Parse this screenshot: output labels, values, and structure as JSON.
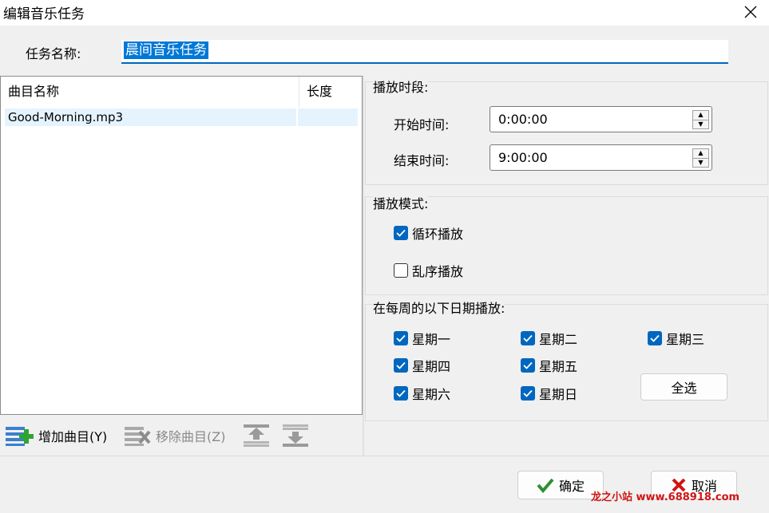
{
  "window": {
    "title": "编辑音乐任务",
    "close_icon": "close-icon"
  },
  "task_name": {
    "label": "任务名称:",
    "value": "晨间音乐任务"
  },
  "song_table": {
    "columns": [
      "曲目名称",
      "长度"
    ],
    "rows": [
      {
        "name": "Good-Morning.mp3",
        "length": ""
      }
    ]
  },
  "toolbar": {
    "add_label": "增加曲目(Y)",
    "remove_label": "移除曲目(Z)",
    "move_up_icon": "move-up-icon",
    "move_down_icon": "move-down-icon"
  },
  "time_period": {
    "title": "播放时段:",
    "start_label": "开始时间:",
    "start_value": "0:00:00",
    "end_label": "结束时间:",
    "end_value": "9:00:00"
  },
  "play_mode": {
    "title": "播放模式:",
    "loop_label": "循环播放",
    "loop_checked": true,
    "shuffle_label": "乱序播放",
    "shuffle_checked": false
  },
  "weekdays": {
    "title": "在每周的以下日期播放:",
    "days": [
      {
        "label": "星期一",
        "checked": true
      },
      {
        "label": "星期二",
        "checked": true
      },
      {
        "label": "星期三",
        "checked": true
      },
      {
        "label": "星期四",
        "checked": true
      },
      {
        "label": "星期五",
        "checked": true
      },
      {
        "label": "星期六",
        "checked": true
      },
      {
        "label": "星期日",
        "checked": true
      }
    ],
    "select_all_label": "全选"
  },
  "footer": {
    "ok_label": "确定",
    "cancel_label": "取消"
  },
  "watermark": "龙之小站 www.688918.com",
  "colors": {
    "accent": "#0067c0",
    "selection": "#0078d7",
    "row_highlight": "#e5f3ff",
    "ok_check": "#2f8f2f",
    "cancel_x": "#d01414"
  }
}
